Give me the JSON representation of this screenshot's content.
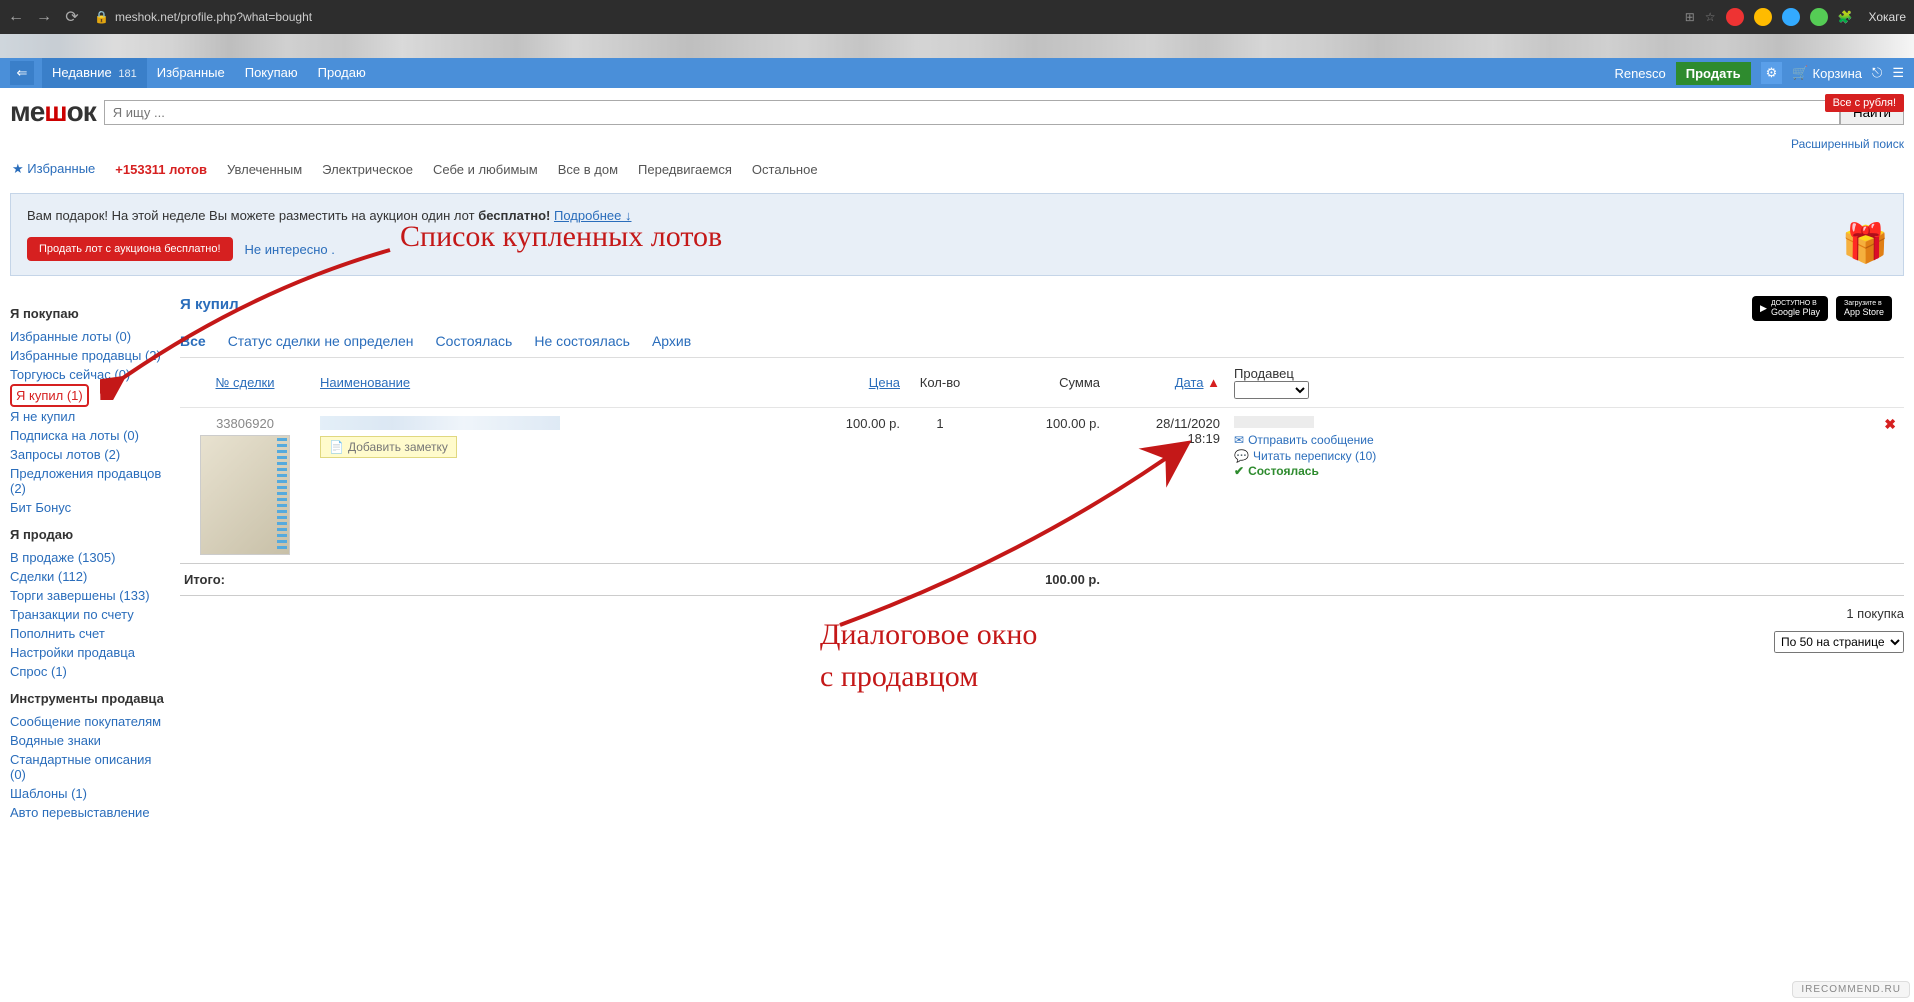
{
  "browser": {
    "url": "meshok.net/profile.php?what=bought",
    "user": "Хокаге"
  },
  "topbar": {
    "tabs": [
      {
        "label": "Недавние",
        "count": "181"
      },
      {
        "label": "Избранные"
      },
      {
        "label": "Покупаю"
      },
      {
        "label": "Продаю"
      }
    ],
    "username": "Renesco",
    "sell": "Продать",
    "basket": "Корзина"
  },
  "header": {
    "search_placeholder": "Я ищу ...",
    "search_btn": "Найти",
    "red_pill": "Все с рубля!",
    "adv_search": "Расширенный поиск"
  },
  "categories": {
    "fav": "Избранные",
    "lot_count": "+153311 лотов",
    "items": [
      "Увлеченным",
      "Электрическое",
      "Себе и любимым",
      "Все в дом",
      "Передвигаемся",
      "Остальное"
    ]
  },
  "promo": {
    "text_pre": "Вам подарок! На этой неделе Вы можете разместить на аукцион один лот ",
    "text_bold": "бесплатно!",
    "more": "Подробнее ↓",
    "btn": "Продать лот с аукциона бесплатно!",
    "not_interesting": "Не интересно ."
  },
  "sidebar": {
    "buy_header": "Я покупаю",
    "buy_items": [
      "Избранные лоты (0)",
      "Избранные продавцы (2)",
      "Торгуюсь сейчас (0)",
      "Я купил (1)",
      "Я не купил",
      "Подписка на лоты (0)",
      "Запросы лотов (2)",
      "Предложения продавцов (2)",
      "Бит Бонус"
    ],
    "sell_header": "Я продаю",
    "sell_items": [
      "В продаже (1305)",
      "Сделки (112)",
      "Торги завершены (133)",
      "Транзакции по счету",
      "Пополнить счет",
      "Настройки продавца",
      "Спрос (1)"
    ],
    "tools_header": "Инструменты продавца",
    "tools_items": [
      "Сообщение покупателям",
      "Водяные знаки",
      "Стандартные описания (0)",
      "Шаблоны (1)",
      "Авто перевыставление"
    ]
  },
  "content": {
    "title": "Я купил",
    "google_play": "Google Play",
    "app_store": "App Store",
    "tabs": [
      "Все",
      "Статус сделки не определен",
      "Состоялась",
      "Не состоялась",
      "Архив"
    ],
    "columns": {
      "num": "№ сделки",
      "name": "Наименование",
      "price": "Цена",
      "qty": "Кол-во",
      "sum": "Сумма",
      "date": "Дата",
      "seller": "Продавец"
    },
    "row": {
      "deal_num": "33806920",
      "price": "100.00 р.",
      "qty": "1",
      "sum": "100.00 р.",
      "date": "28/11/2020",
      "time": "18:19",
      "add_note": "Добавить заметку",
      "send_msg": "Отправить сообщение",
      "read_msg": "Читать переписку (10)",
      "status": "Состоялась"
    },
    "total_label": "Итого:",
    "total_sum": "100.00 р.",
    "purchases_count": "1 покупка",
    "per_page": "По 50 на странице"
  },
  "annotations": {
    "top": "Список купленных лотов",
    "bottom1": "Диалоговое окно",
    "bottom2": "с продавцом"
  },
  "watermark": "IRECOMMEND.RU"
}
